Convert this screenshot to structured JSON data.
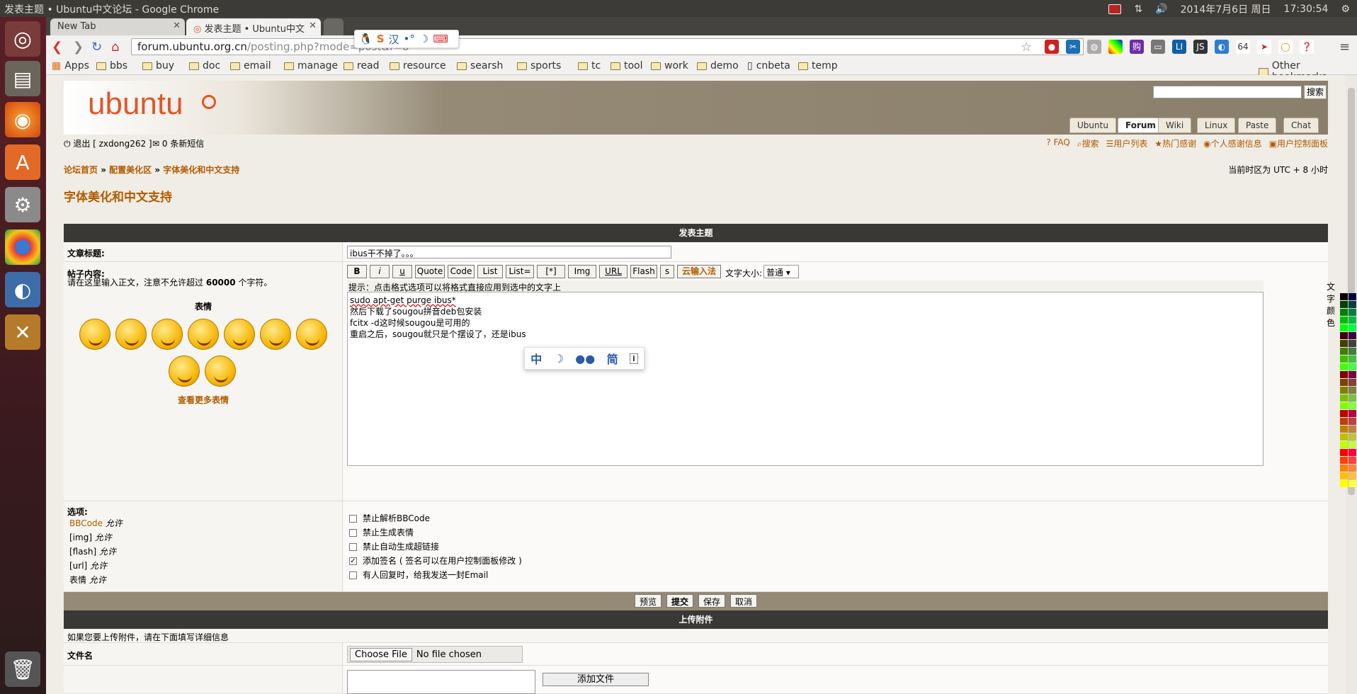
{
  "window": {
    "title": "发表主题 • Ubuntu中文论坛 - Google Chrome"
  },
  "system": {
    "datetime": "2014年7月6日 周日",
    "time": "17:30:54"
  },
  "tabs": [
    {
      "label": "New Tab"
    },
    {
      "label": "发表主题 • Ubuntu中文"
    }
  ],
  "omnibox": {
    "host": "forum.ubuntu.org.cn",
    "path": "/posting.php?mode=post&f=8"
  },
  "ime": {
    "label": "汉"
  },
  "bookmarks": {
    "apps": "Apps",
    "items": [
      "bbs",
      "buy",
      "doc",
      "email",
      "manage",
      "read",
      "resource",
      "searsh",
      "sports",
      "tc",
      "tool",
      "work",
      "demo",
      "cnbeta",
      "temp"
    ],
    "other": "Other bookmarks"
  },
  "site": {
    "logo": "ubuntu",
    "search_button": "搜索",
    "nav_tabs": [
      "Ubuntu",
      "Forum",
      "Wiki",
      "Linux",
      "Paste",
      "Chat"
    ],
    "active_tab": "Forum",
    "logout": "退出 [ zxdong262 ]",
    "messages": "0 条新短信",
    "toplinks": [
      "FAQ",
      "搜索",
      "用户列表",
      "热门感谢",
      "个人感谢信息",
      "用户控制面板"
    ],
    "breadcrumb": [
      "论坛首页",
      "配置美化区",
      "字体美化和中文支持"
    ],
    "timezone": "当前时区为 UTC + 8 小时",
    "forum_title": "字体美化和中文支持"
  },
  "post": {
    "section_title": "发表主题",
    "subject_label": "文章标题:",
    "subject_value": "ibus干不掉了。。。",
    "body_label": "帖子内容:",
    "body_hint_prefix": "请在这里输入正文，注意不允许超过",
    "body_hint_count": "60000",
    "body_hint_suffix": "个字符。",
    "smilies_title": "表情",
    "more_smilies": "查看更多表情",
    "bbcode_buttons": [
      "B",
      "i",
      "u",
      "Quote",
      "Code",
      "List",
      "List=",
      "[*]",
      "Img",
      "URL",
      "Flash",
      "s"
    ],
    "cloud_ime": "云输入法",
    "font_size_label": "文字大小:",
    "font_size_value": "普通",
    "help_line": "提示：点击格式选项可以将格式直接应用到选中的文字上",
    "font_color_label": "文字颜色",
    "body_lines": [
      "sudo apt-get purge ibus*",
      "然后下载了sougou拼音deb包安装",
      "fcitx -d这时候sougou是可用的",
      "重启之后，sougou就只是个摆设了，还是ibus"
    ],
    "ime_popup": [
      "中",
      "☽",
      "●●",
      "简",
      "i"
    ]
  },
  "options": {
    "label": "选项:",
    "left": [
      {
        "name": "BBCode",
        "state": "允许"
      },
      {
        "name": "[img]",
        "state": "允许"
      },
      {
        "name": "[flash]",
        "state": "允许"
      },
      {
        "name": "[url]",
        "state": "允许"
      },
      {
        "name": "表情",
        "state": "允许"
      }
    ],
    "checks": [
      {
        "label": "禁止解析BBCode",
        "checked": false
      },
      {
        "label": "禁止生成表情",
        "checked": false
      },
      {
        "label": "禁止自动生成超链接",
        "checked": false
      },
      {
        "label": "添加签名 ( 签名可以在用户控制面板修改 )",
        "checked": true
      },
      {
        "label": "有人回复时，给我发送一封Email",
        "checked": false
      }
    ]
  },
  "actions": {
    "preview": "预览",
    "submit": "提交",
    "save": "保存",
    "cancel": "取消"
  },
  "attach": {
    "title": "上传附件",
    "hint": "如果您要上传附件，请在下面填写详细信息",
    "file_label": "文件名",
    "choose": "Choose File",
    "no_file": "No file chosen",
    "add": "添加文件"
  }
}
